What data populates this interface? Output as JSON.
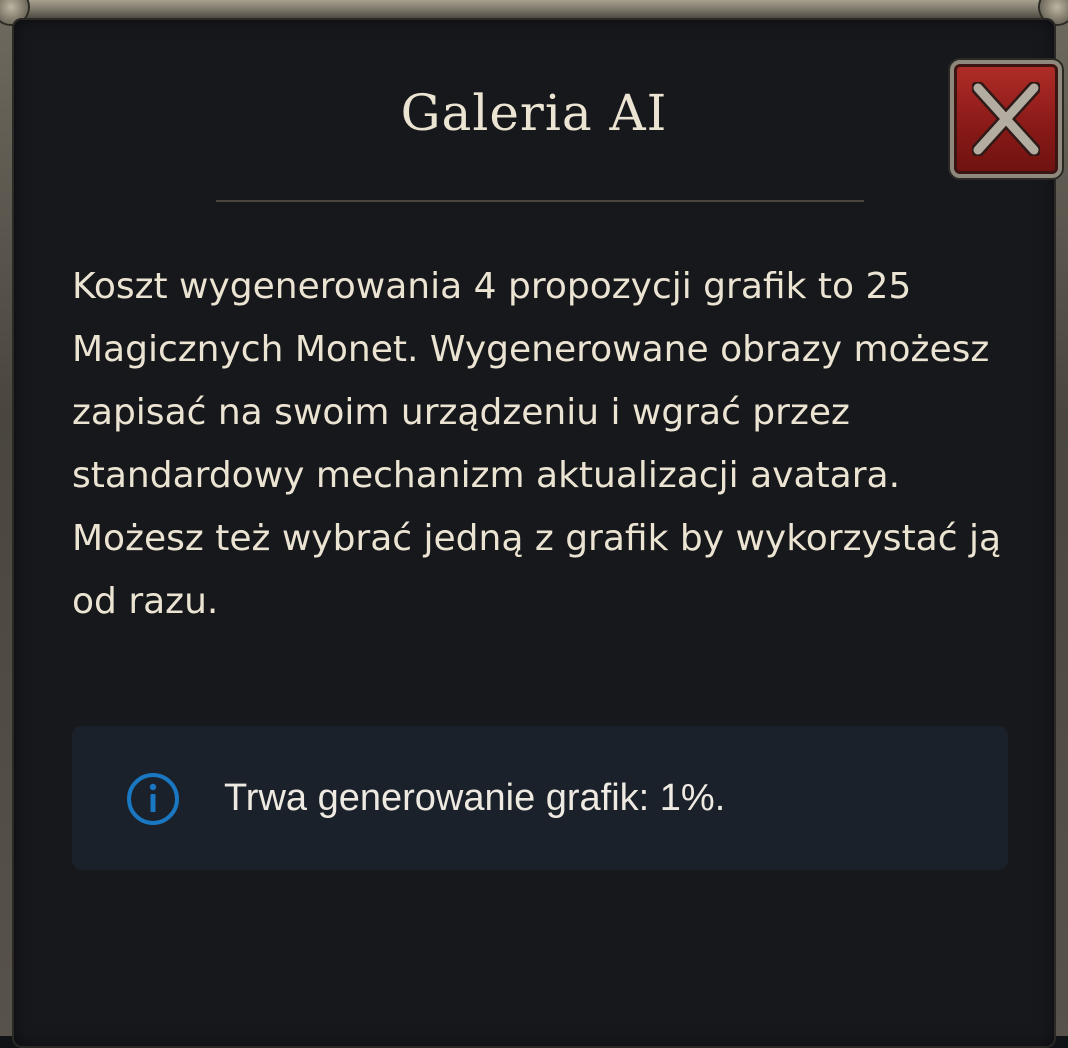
{
  "dialog": {
    "title": "Galeria AI",
    "close_icon": "close-x-icon",
    "description": "Koszt wygenerowania 4 propozycji grafik to 25 Magicznych Monet. Wygenerowane obrazy możesz zapisać na swoim urządzeniu i wgrać przez standardowy mechanizm aktualizacji avatara. Możesz też wybrać jedną z grafik by wykorzystać ją od razu.",
    "status": {
      "icon": "info-icon",
      "text": "Trwa generowanie grafik: 1%.",
      "progress_percent": 1
    }
  },
  "colors": {
    "background": "#17181c",
    "text": "#ece4d2",
    "close_button": "#a3221f",
    "info_box": "#1b212b",
    "info_icon": "#1a78c2"
  }
}
